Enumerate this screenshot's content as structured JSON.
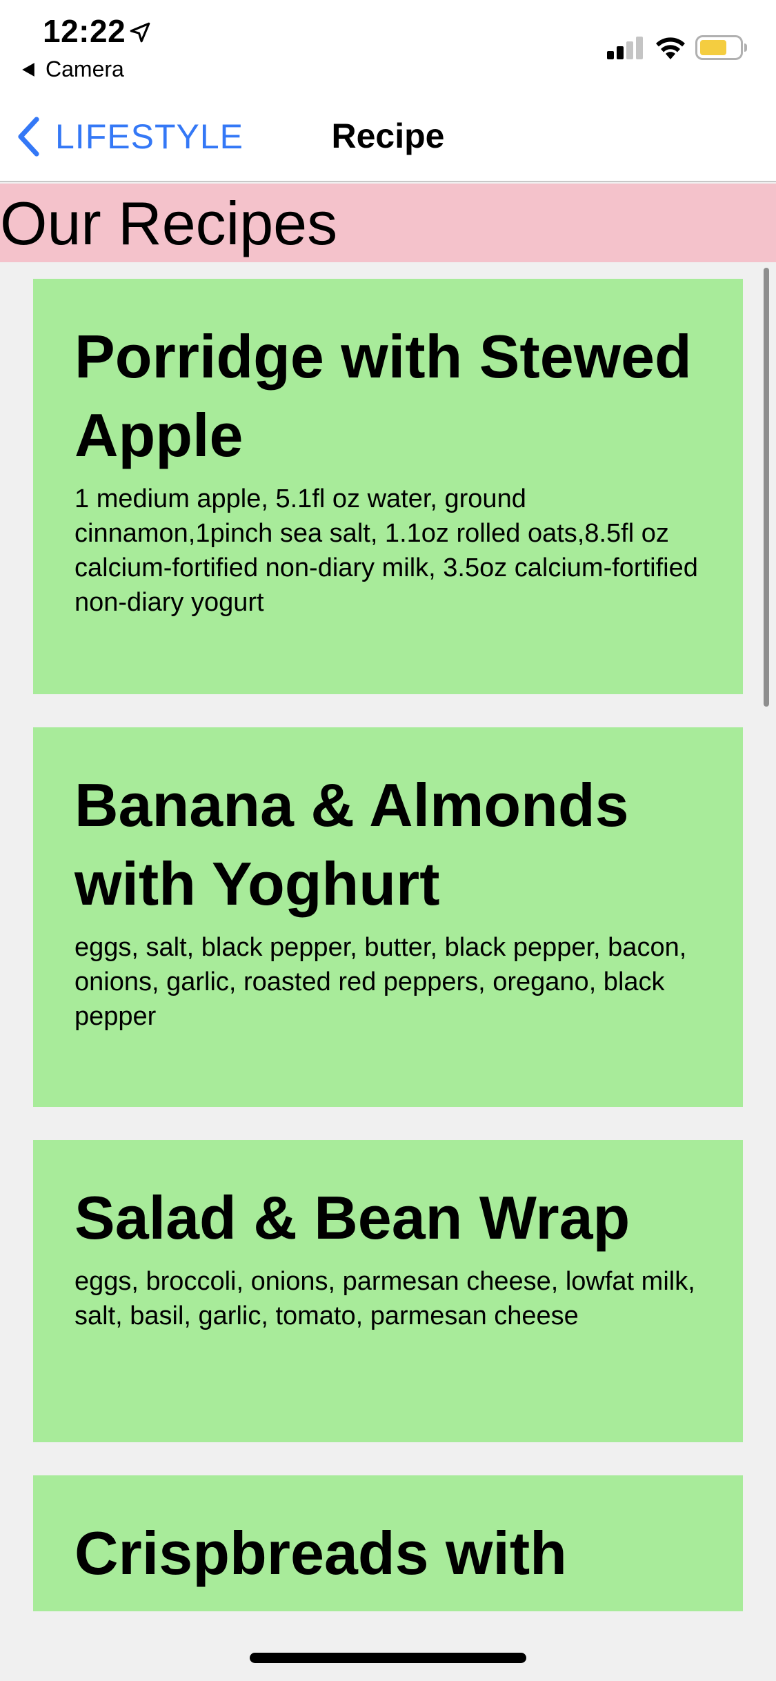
{
  "status_bar": {
    "time": "12:22",
    "back_app_label": "Camera"
  },
  "nav": {
    "back_label": "LIFESTYLE",
    "title": "Recipe",
    "accent_color": "#3478f6"
  },
  "section": {
    "title": "Our Recipes",
    "header_color": "#f4c2cb"
  },
  "recipes": [
    {
      "name": "Porridge with Stewed Apple",
      "ingredients": "1 medium apple, 5.1fl oz water, ground cinnamon,1pinch sea salt, 1.1oz rolled oats,8.5fl oz calcium-fortified non-diary milk, 3.5oz calcium-fortified non-diary yogurt"
    },
    {
      "name": "Banana & Almonds with Yoghurt",
      "ingredients": "eggs, salt, black pepper, butter, black pepper, bacon, onions, garlic, roasted red peppers, oregano, black pepper"
    },
    {
      "name": "Salad & Bean Wrap",
      "ingredients": "eggs, broccoli, onions, parmesan cheese, lowfat milk, salt, basil, garlic, tomato, parmesan cheese"
    },
    {
      "name": "Crispbreads with",
      "ingredients": ""
    }
  ],
  "card_color": "#a8eb9a",
  "icons": {
    "location": "location-arrow-icon",
    "signal": "cellular-signal-icon",
    "wifi": "wifi-icon",
    "battery": "battery-icon",
    "back": "chevron-left-icon"
  }
}
